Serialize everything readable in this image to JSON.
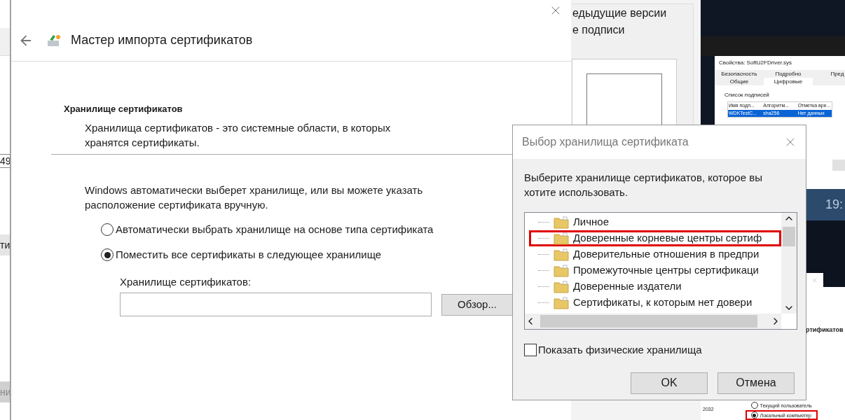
{
  "background_fragments": [
    "49",
    "ти",
    "ни"
  ],
  "back_window": {
    "lines": [
      "едыдущие версии",
      "е подписи"
    ]
  },
  "properties_window": {
    "title": "Свойства: SoftU2FDriver.sys",
    "tabs": [
      {
        "label": "Безопасность",
        "selected": false
      },
      {
        "label": "Подробно",
        "selected": false
      },
      {
        "label": "Пред",
        "selected": false
      },
      {
        "label": "Общие",
        "selected": false
      },
      {
        "label": "Цифровые",
        "selected": true
      }
    ],
    "group_label": "Список подписей",
    "columns": [
      "Имя подп...",
      "Алгоритм...",
      "Отметка вре..."
    ],
    "rows": [
      {
        "cells": [
          "WDKTestC...",
          "sha256",
          "Нет данных"
        ],
        "selected": true
      }
    ]
  },
  "clock": "19:",
  "lower_panel": {
    "heading": "ртификатов",
    "year": "2032",
    "options": [
      {
        "label": "Текущий пользователь",
        "selected": false,
        "highlighted": false
      },
      {
        "label": "Локальный компьютер",
        "selected": true,
        "highlighted": true
      }
    ]
  },
  "wizard": {
    "title": "Мастер импорта сертификатов",
    "heading": "Хранилище сертификатов",
    "description": "Хранилища сертификатов - это системные области, в которых хранятся сертификаты.",
    "instruction": "Windows автоматически выберет хранилище, или вы можете указать расположение сертификата вручную.",
    "options": [
      {
        "label": "Автоматически выбрать хранилище на основе типа сертификата",
        "selected": false
      },
      {
        "label": "Поместить все сертификаты в следующее хранилище",
        "selected": true
      }
    ],
    "store_label": "Хранилище сертификатов:",
    "browse_button": "Обзор..."
  },
  "store_dialog": {
    "title": "Выбор хранилища сертификата",
    "prompt": "Выберите хранилище сертификатов, которое вы хотите использовать.",
    "items": [
      {
        "label": "Личное",
        "highlighted": false
      },
      {
        "label": "Доверенные корневые центры сертиф",
        "highlighted": true
      },
      {
        "label": "Доверительные отношения в предпри",
        "highlighted": false
      },
      {
        "label": "Промежуточные центры сертификаци",
        "highlighted": false
      },
      {
        "label": "Доверенные издатели",
        "highlighted": false
      },
      {
        "label": "Сертификаты, к которым нет довери",
        "highlighted": false
      }
    ],
    "show_physical": {
      "label": "Показать физические хранилища",
      "checked": false
    },
    "buttons": [
      "OK",
      "Отмена"
    ]
  }
}
